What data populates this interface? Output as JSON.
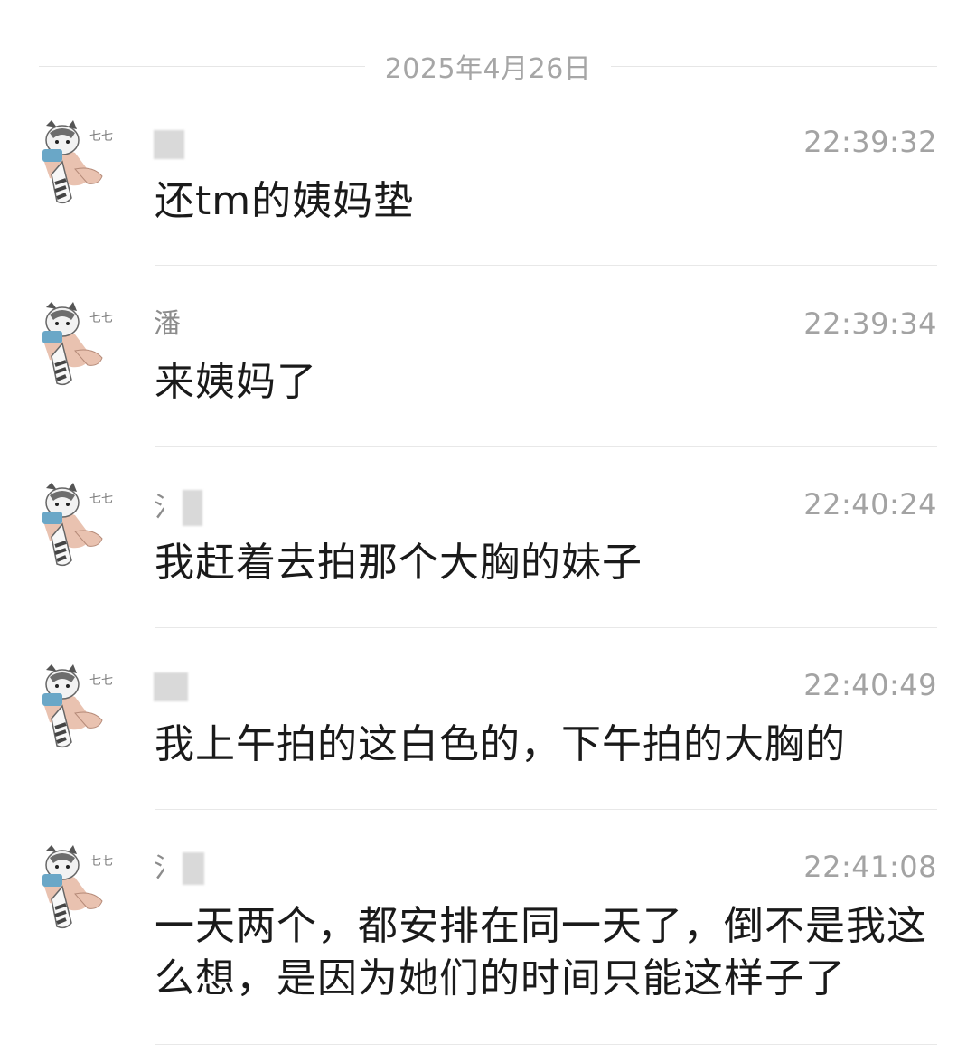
{
  "date_separator": "2025年4月26日",
  "messages": [
    {
      "sender_char": "",
      "time": "22:39:32",
      "text": "还tm的姨妈垫"
    },
    {
      "sender_char": "潘",
      "time": "22:39:34",
      "text": "来姨妈了"
    },
    {
      "sender_char": "氵",
      "time": "22:40:24",
      "text": "我赶着去拍那个大胸的妹子"
    },
    {
      "sender_char": "",
      "time": "22:40:49",
      "text": "我上午拍的这白色的，下午拍的大胸的"
    },
    {
      "sender_char": "氵",
      "time": "22:41:08",
      "text": "一天两个，都安排在同一天了，倒不是我这么想，是因为她们的时间只能这样子了"
    }
  ],
  "avatar_icon": "cat-sticker-avatar-icon",
  "colors": {
    "time_text": "#a3a3a3",
    "date_text": "#a6a6a6",
    "divider": "#e8e8e8"
  }
}
